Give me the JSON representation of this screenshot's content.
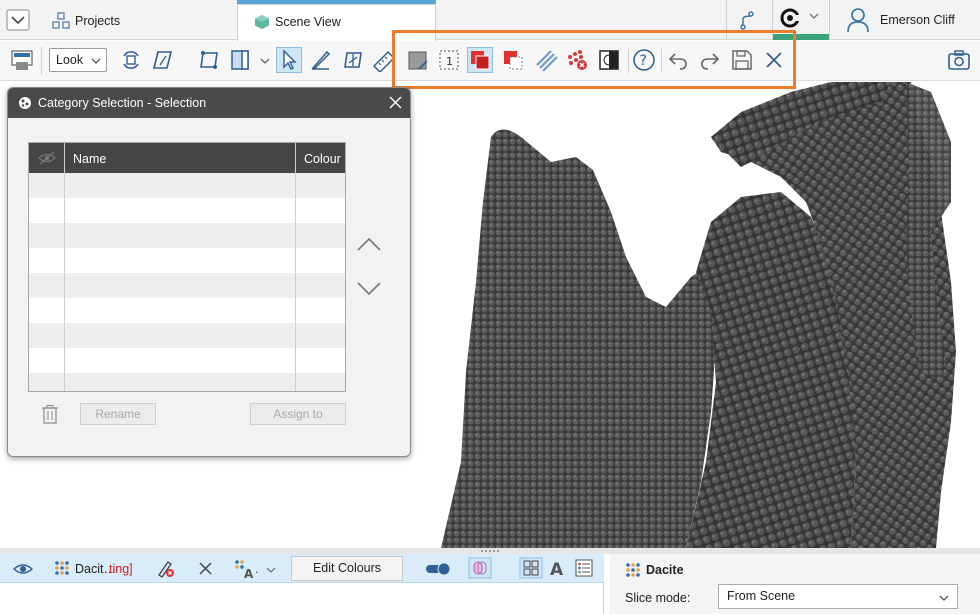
{
  "tabs": {
    "projects_label": "Projects",
    "scene_view_label": "Scene View"
  },
  "user": {
    "name": "Emerson Cliff"
  },
  "toolbar": {
    "look_label": "Look"
  },
  "dialog": {
    "title": "Category Selection - Selection",
    "columns": [
      "Name",
      "Colour"
    ],
    "rename_label": "Rename",
    "assign_label": "Assign to"
  },
  "bottom_left": {
    "object_prefix": "Dacit…",
    "object_suffix": "ting]",
    "edit_colours_label": "Edit Colours"
  },
  "bottom_right": {
    "title": "Dacite",
    "slice_mode_label": "Slice mode:",
    "slice_mode_value": "From Scene"
  },
  "colors": {
    "accent_blue": "#5aa6d6",
    "highlight_orange": "#f07b2a",
    "selection_red": "#e03030",
    "scene_object": "#404040",
    "seq_green": "#3aa37a"
  }
}
